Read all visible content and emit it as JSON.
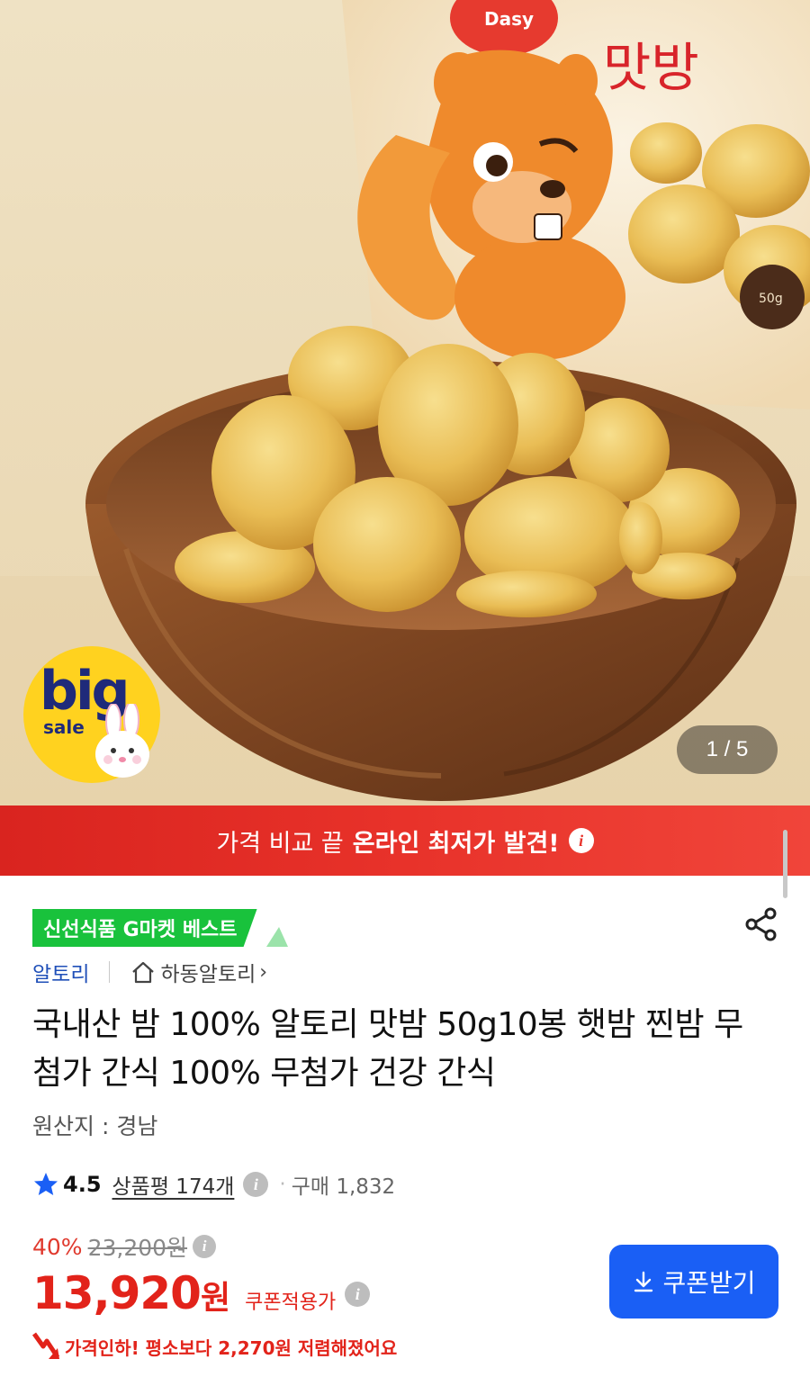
{
  "hero": {
    "package_text": "맛방",
    "package_brand": "Dasy",
    "package_weight": "50g",
    "big_sale": {
      "big": "big",
      "sale": "sale"
    },
    "pager": "1 / 5",
    "image_index": 1,
    "image_count": 5
  },
  "banner": {
    "light_text": "가격 비교 끝",
    "bold_text": "온라인 최저가 발견!",
    "info_glyph": "i"
  },
  "badge": {
    "label": "신선식품 G마켓 베스트"
  },
  "seller": {
    "brand": "알토리",
    "shop": "하동알토리",
    "chevron": "›"
  },
  "product": {
    "title": "국내산 밤 100% 알토리 맛밤 50g10봉 햇밤 찐밤 무첨가 간식 100% 무첨가 건강 간식",
    "origin": "원산지 : 경남"
  },
  "rating": {
    "score": "4.5",
    "reviews_label": "상품평 174개",
    "dot": "·",
    "purchases_label": "구매 1,832"
  },
  "price": {
    "discount": "40%",
    "original": "23,200원",
    "current": "13,920",
    "currency": "원",
    "coupon_applied_label": "쿠폰적용가",
    "coupon_button": "쿠폰받기",
    "price_drop_message": "가격인하! 평소보다 2,270원 저렴해졌어요"
  },
  "icons": {
    "share": "share-icon",
    "home": "home-icon",
    "star": "star-icon",
    "info": "info-icon",
    "download": "download-icon",
    "price_drop": "down-arrow-icon"
  },
  "colors": {
    "banner_red": "#e8322a",
    "badge_green": "#19c23c",
    "price_red": "#e2231a",
    "coupon_blue": "#1a5ff5",
    "brand_blue": "#1f4fb8",
    "star_blue": "#1a5ff5",
    "big_sale_yellow": "#ffd21f"
  }
}
